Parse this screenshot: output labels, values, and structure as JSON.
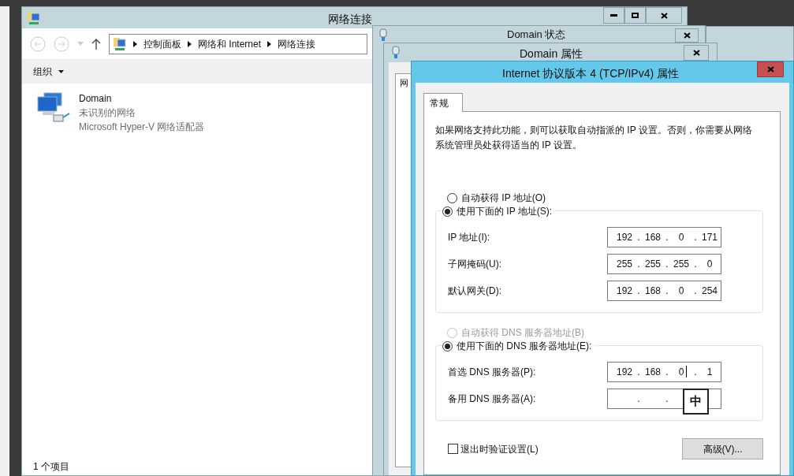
{
  "explorer": {
    "title": "网络连接",
    "breadcrumb": [
      "控制面板",
      "网络和 Internet",
      "网络连接"
    ],
    "toolbar": {
      "organize": "组织"
    },
    "items": [
      {
        "name": "Domain",
        "status": "未识别的网络",
        "adapter": "Microsoft Hyper-V 网络适配器"
      }
    ],
    "status_bar": "1 个项目"
  },
  "status_window": {
    "title": "Domain 状态"
  },
  "properties_window": {
    "title": "Domain 属性",
    "tab": "网"
  },
  "ipv4_dialog": {
    "title": "Internet 协议版本 4 (TCP/IPv4) 属性",
    "tabs": [
      {
        "label": "常规",
        "selected": true
      }
    ],
    "description": "如果网络支持此功能，则可以获取自动指派的 IP 设置。否则，你需要从网络系统管理员处获得适当的 IP 设置。",
    "ip_mode": [
      {
        "label": "自动获得 IP 地址(O)",
        "selected": false,
        "disabled": false
      },
      {
        "label": "使用下面的 IP 地址(S):",
        "selected": true,
        "disabled": false
      }
    ],
    "ip_fields": [
      {
        "kind": "filled",
        "label": "IP 地址(I):",
        "parts": [
          "192",
          ".",
          "168",
          ".",
          "0",
          ".",
          "171"
        ],
        "focused": false
      },
      {
        "kind": "filled",
        "label": "子网掩码(U):",
        "parts": [
          "255",
          ".",
          "255",
          ".",
          "255",
          ".",
          "0"
        ],
        "focused": false
      },
      {
        "kind": "filled",
        "label": "默认网关(D):",
        "parts": [
          "192",
          ".",
          "168",
          ".",
          "0",
          ".",
          "254"
        ],
        "focused": false
      }
    ],
    "dns_mode": [
      {
        "label": "自动获得 DNS 服务器地址(B)",
        "selected": false,
        "disabled": true
      },
      {
        "label": "使用下面的 DNS 服务器地址(E):",
        "selected": true,
        "disabled": false
      }
    ],
    "dns_fields": [
      {
        "kind": "filled",
        "label": "首选 DNS 服务器(P):",
        "parts": [
          "192",
          ".",
          "168",
          ".",
          "0",
          ".",
          "1"
        ],
        "focused": true
      },
      {
        "kind": "blank",
        "label": "备用 DNS 服务器(A):",
        "parts": [
          ".",
          "."
        ]
      }
    ],
    "validate_on_exit": {
      "label": "退出时验证设置(L)",
      "checked": false
    },
    "advanced_button": "高级(V)..."
  },
  "ime_indicator": "中"
}
